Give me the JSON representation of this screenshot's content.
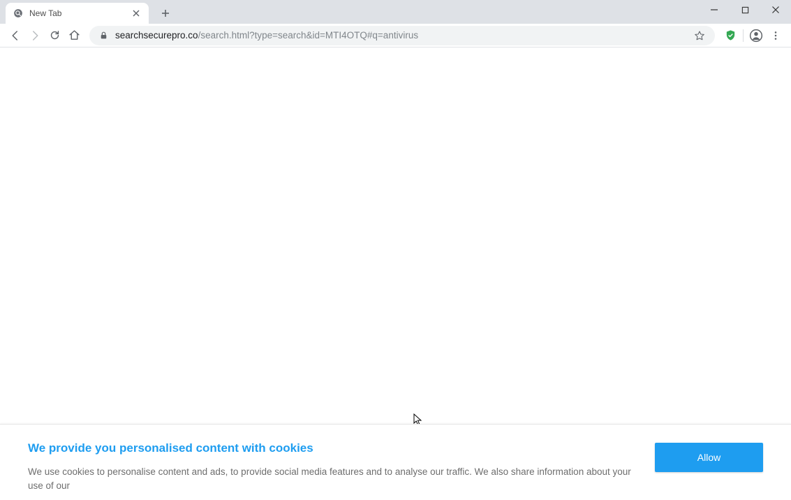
{
  "tab": {
    "title": "New Tab"
  },
  "url": {
    "host": "searchsecurepro.co",
    "path": "/search.html?type=search&id=MTI4OTQ#q=antivirus"
  },
  "cookie": {
    "title": "We provide you personalised content with cookies",
    "body": "We use cookies to personalise content and ads, to provide social media features and to analyse our traffic. We also share information about your use of our",
    "allow": "Allow"
  }
}
